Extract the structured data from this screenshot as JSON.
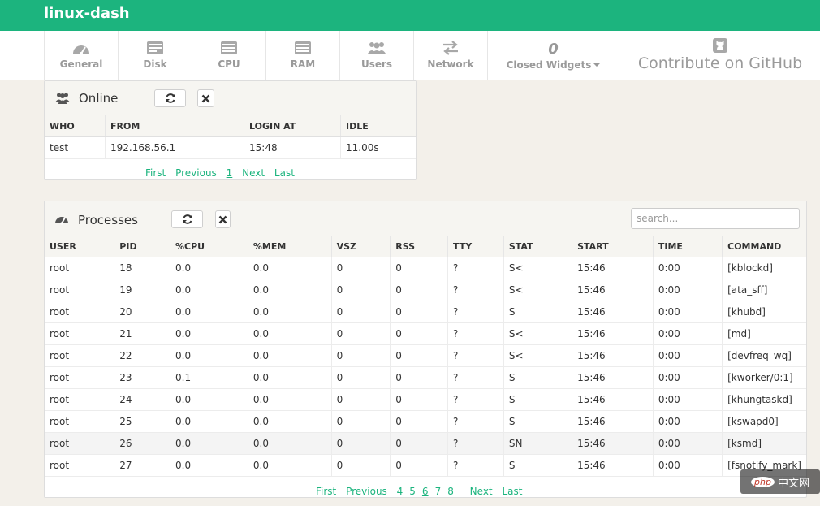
{
  "app": {
    "title": "linux-dash"
  },
  "nav": {
    "items": [
      {
        "label": "General",
        "icon": "speedometer-icon"
      },
      {
        "label": "Disk",
        "icon": "disk-icon"
      },
      {
        "label": "CPU",
        "icon": "cpu-icon"
      },
      {
        "label": "RAM",
        "icon": "ram-icon"
      },
      {
        "label": "Users",
        "icon": "users-icon"
      },
      {
        "label": "Network",
        "icon": "exchange-arrows-icon"
      }
    ],
    "closed": {
      "count": "0",
      "label": "Closed Widgets"
    },
    "github": {
      "label": "Contribute on GitHub"
    }
  },
  "online": {
    "title": "Online",
    "columns": [
      "WHO",
      "FROM",
      "LOGIN AT",
      "IDLE"
    ],
    "rows": [
      [
        "test",
        "192.168.56.1",
        "15:48",
        "11.00s"
      ]
    ],
    "pager": {
      "first": "First",
      "previous": "Previous",
      "page": "1",
      "next": "Next",
      "last": "Last"
    }
  },
  "processes": {
    "title": "Processes",
    "search_placeholder": "search...",
    "columns": [
      "USER",
      "PID",
      "%CPU",
      "%MEM",
      "VSZ",
      "RSS",
      "TTY",
      "STAT",
      "START",
      "TIME",
      "COMMAND"
    ],
    "rows": [
      [
        "root",
        "18",
        "0.0",
        "0.0",
        "0",
        "0",
        "?",
        "S<",
        "15:46",
        "0:00",
        "[kblockd]"
      ],
      [
        "root",
        "19",
        "0.0",
        "0.0",
        "0",
        "0",
        "?",
        "S<",
        "15:46",
        "0:00",
        "[ata_sff]"
      ],
      [
        "root",
        "20",
        "0.0",
        "0.0",
        "0",
        "0",
        "?",
        "S",
        "15:46",
        "0:00",
        "[khubd]"
      ],
      [
        "root",
        "21",
        "0.0",
        "0.0",
        "0",
        "0",
        "?",
        "S<",
        "15:46",
        "0:00",
        "[md]"
      ],
      [
        "root",
        "22",
        "0.0",
        "0.0",
        "0",
        "0",
        "?",
        "S<",
        "15:46",
        "0:00",
        "[devfreq_wq]"
      ],
      [
        "root",
        "23",
        "0.1",
        "0.0",
        "0",
        "0",
        "?",
        "S",
        "15:46",
        "0:00",
        "[kworker/0:1]"
      ],
      [
        "root",
        "24",
        "0.0",
        "0.0",
        "0",
        "0",
        "?",
        "S",
        "15:46",
        "0:00",
        "[khungtaskd]"
      ],
      [
        "root",
        "25",
        "0.0",
        "0.0",
        "0",
        "0",
        "?",
        "S",
        "15:46",
        "0:00",
        "[kswapd0]"
      ],
      [
        "root",
        "26",
        "0.0",
        "0.0",
        "0",
        "0",
        "?",
        "SN",
        "15:46",
        "0:00",
        "[ksmd]"
      ],
      [
        "root",
        "27",
        "0.0",
        "0.0",
        "0",
        "0",
        "?",
        "S",
        "15:46",
        "0:00",
        "[fsnotify_mark]"
      ]
    ],
    "highlighted_row": 8,
    "pager": {
      "first": "First",
      "previous": "Previous",
      "pages": [
        "4",
        "5",
        "6",
        "7",
        "8"
      ],
      "current": "6",
      "next": "Next",
      "last": "Last"
    }
  },
  "watermark": {
    "logo": "php",
    "text": "中文网"
  },
  "colors": {
    "brand": "#1cb47e",
    "background": "#f3f0ea"
  }
}
